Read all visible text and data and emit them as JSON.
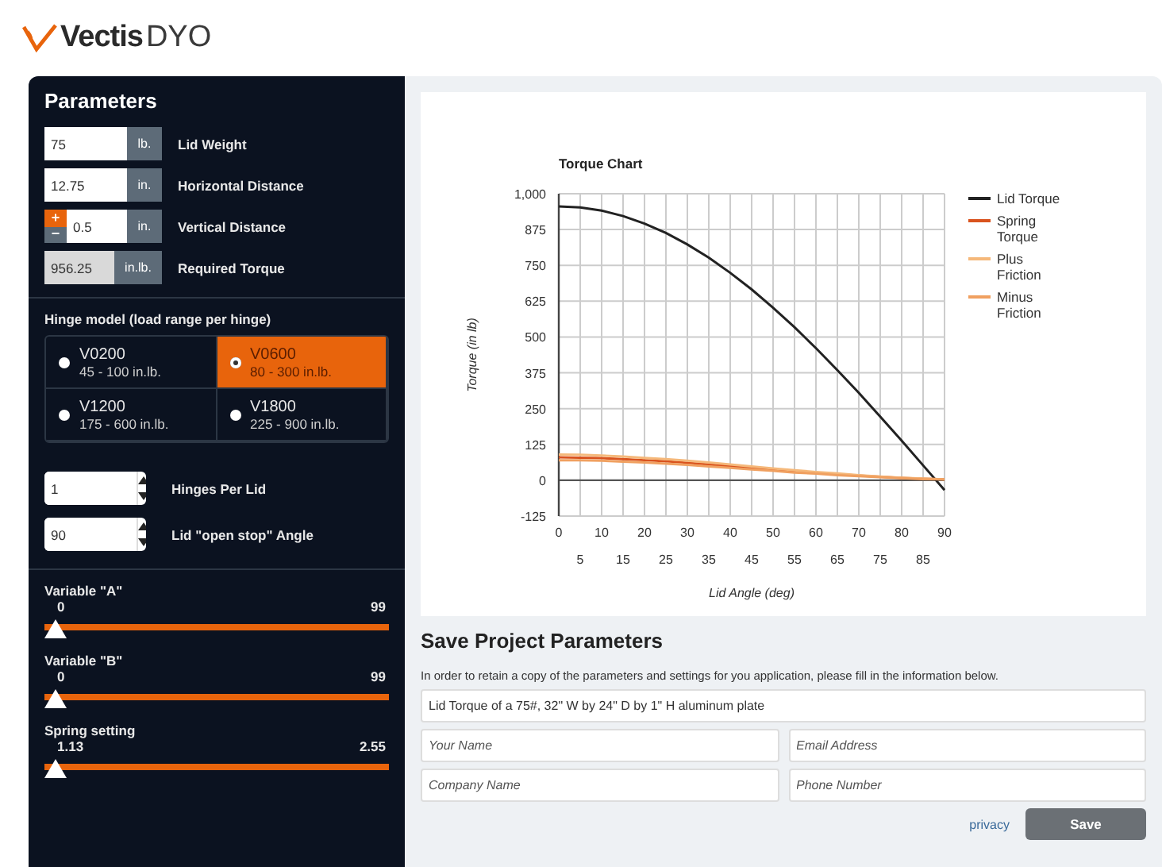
{
  "logo": {
    "name": "Vectis",
    "suffix": "DYO"
  },
  "parameters": {
    "title": "Parameters",
    "inputs": [
      {
        "kind": "plain",
        "value": "75",
        "unit": "lb.",
        "label": "Lid Weight"
      },
      {
        "kind": "plain",
        "value": "12.75",
        "unit": "in.",
        "label": "Horizontal Distance"
      },
      {
        "kind": "stepper",
        "value": "0.5",
        "unit": "in.",
        "label": "Vertical Distance",
        "plus": "+",
        "minus": "−"
      },
      {
        "kind": "readonly",
        "value": "956.25",
        "unit": "in.lb.",
        "label": "Required Torque"
      }
    ]
  },
  "hinge_model": {
    "label": "Hinge model (load range per hinge)",
    "options": [
      {
        "name": "V0200",
        "range": "45 - 100 in.lb.",
        "selected": false
      },
      {
        "name": "V0600",
        "range": "80 - 300 in.lb.",
        "selected": true
      },
      {
        "name": "V1200",
        "range": "175 - 600 in.lb.",
        "selected": false
      },
      {
        "name": "V1800",
        "range": "225 - 900 in.lb.",
        "selected": false
      }
    ]
  },
  "spinners": [
    {
      "value": "1",
      "label": "Hinges Per Lid"
    },
    {
      "value": "90",
      "label": "Lid \"open stop\" Angle"
    }
  ],
  "sliders": [
    {
      "label": "Variable \"A\"",
      "min": "0",
      "max": "99",
      "level": 0.03
    },
    {
      "label": "Variable \"B\"",
      "min": "0",
      "max": "99",
      "level": 0.03
    },
    {
      "label": "Spring setting",
      "min": "1.13",
      "max": "2.55",
      "level": 0.03
    }
  ],
  "chart": {
    "chart_data": {
      "type": "line",
      "title": "Torque Chart",
      "xlabel": "Lid Angle (deg)",
      "ylabel": "Torque (in lb)",
      "x": [
        0,
        5,
        10,
        15,
        20,
        25,
        30,
        35,
        40,
        45,
        50,
        55,
        60,
        65,
        70,
        75,
        80,
        85,
        90
      ],
      "series": [
        {
          "name": "Lid Torque",
          "color": "#222222",
          "values": [
            956,
            952,
            941,
            922,
            896,
            863,
            823,
            777,
            724,
            666,
            602,
            534,
            461,
            384,
            305,
            222,
            138,
            52,
            -34
          ]
        },
        {
          "name": "Spring Torque",
          "color": "#d9531e",
          "values": [
            80,
            79,
            77,
            74,
            70,
            66,
            61,
            55,
            49,
            43,
            37,
            31,
            26,
            21,
            16,
            12,
            8,
            5,
            3
          ]
        },
        {
          "name": "Plus Friction",
          "color": "#f5b87a",
          "values": [
            90,
            89,
            86,
            83,
            78,
            74,
            68,
            62,
            55,
            48,
            41,
            35,
            29,
            24,
            18,
            13,
            9,
            6,
            3
          ]
        },
        {
          "name": "Minus Friction",
          "color": "#f0a060",
          "values": [
            70,
            70,
            68,
            65,
            62,
            58,
            54,
            48,
            43,
            38,
            33,
            27,
            23,
            18,
            14,
            11,
            7,
            4,
            3
          ]
        }
      ],
      "xlim": [
        0,
        90
      ],
      "ylim": [
        -125,
        1000
      ],
      "grid": true,
      "xticks": [
        0,
        10,
        20,
        30,
        40,
        50,
        60,
        70,
        80,
        90
      ],
      "yticks": [
        -125,
        0,
        125,
        250,
        375,
        500,
        625,
        750,
        875,
        {
          "value": 1000,
          "label": "1,000"
        }
      ]
    },
    "second_row_x_labels": [
      "5",
      "15",
      "25",
      "35",
      "45",
      "55",
      "65",
      "75",
      "85"
    ]
  },
  "save": {
    "title": "Save Project Parameters",
    "description": "In order to retain a copy of the parameters and settings for you application, please fill in the information below.",
    "fields": [
      {
        "value": "Lid Torque of a 75#, 32\" W by 24\" D by 1\" H aluminum plate"
      },
      {
        "placeholder": "Your Name"
      },
      {
        "placeholder": "Email Address"
      },
      {
        "placeholder": "Company Name"
      },
      {
        "placeholder": "Phone Number"
      }
    ],
    "privacy": "privacy",
    "button": "Save"
  }
}
